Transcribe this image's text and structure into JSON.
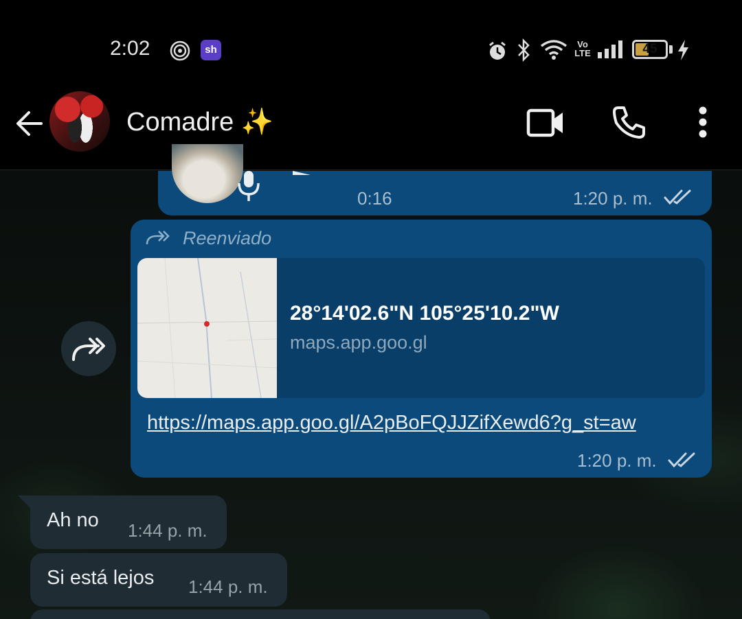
{
  "status_bar": {
    "time": "2:02",
    "battery_level": "45",
    "battery_fraction": 0.45,
    "signal_label_top": "Vo",
    "signal_label_bottom": "LTE",
    "app_badge": "sh",
    "icons": [
      "hotspot-icon",
      "app-badge-icon",
      "alarm-icon",
      "bluetooth-icon",
      "wifi-icon",
      "volte-icon",
      "signal-icon",
      "battery-icon",
      "charging-icon"
    ]
  },
  "header": {
    "contact_name": "Comadre ✨",
    "icons": [
      "back-arrow-icon",
      "video-call-icon",
      "voice-call-icon",
      "more-options-icon"
    ]
  },
  "messages": {
    "voice_note": {
      "duration": "0:16",
      "time": "1:20 p. m."
    },
    "forwarded": {
      "label": "Reenviado",
      "card_title": "28°14'02.6\"N 105°25'10.2\"W",
      "card_domain": "maps.app.goo.gl",
      "url": "https://maps.app.goo.gl/A2pBoFQJJZifXewd6?g_st=aw",
      "time": "1:20 p. m."
    },
    "incoming": [
      {
        "text": "Ah no",
        "time": "1:44 p. m."
      },
      {
        "text": "Si está lejos",
        "time": "1:44 p. m."
      }
    ]
  },
  "colors": {
    "outgoing_bubble": "#0b4a7a",
    "incoming_bubble": "#1f2c33",
    "header_bg": "#000000",
    "read_ticks": "#a9bfd0"
  }
}
